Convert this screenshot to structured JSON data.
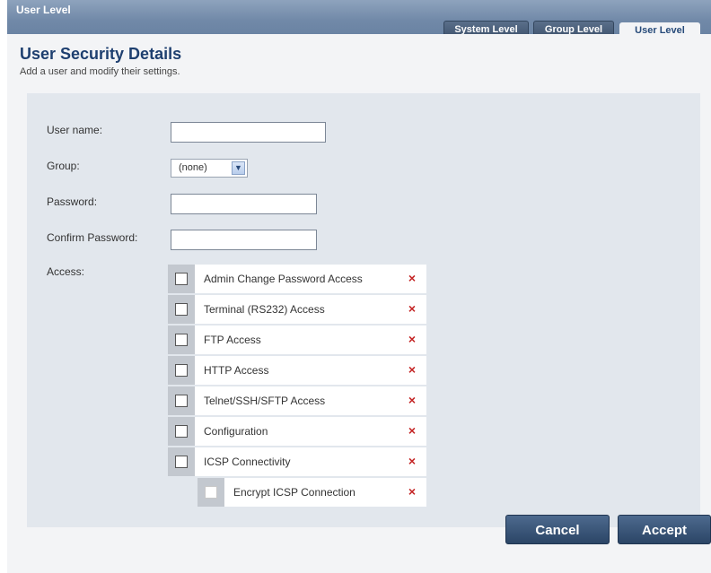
{
  "header": {
    "title": "User Level"
  },
  "tabs": [
    {
      "label": "System Level",
      "active": false
    },
    {
      "label": "Group Level",
      "active": false
    },
    {
      "label": "User Level",
      "active": true
    }
  ],
  "page": {
    "title": "User Security Details",
    "subtitle": "Add a user and modify their settings."
  },
  "form": {
    "username": {
      "label": "User name:",
      "value": ""
    },
    "group": {
      "label": "Group:",
      "selected": "(none)"
    },
    "password": {
      "label": "Password:",
      "value": ""
    },
    "confirm_password": {
      "label": "Confirm Password:",
      "value": ""
    },
    "access": {
      "label": "Access:",
      "items": [
        {
          "label": "Admin Change Password Access",
          "checked": false,
          "enabled": true
        },
        {
          "label": "Terminal (RS232) Access",
          "checked": false,
          "enabled": true
        },
        {
          "label": "FTP Access",
          "checked": false,
          "enabled": true
        },
        {
          "label": "HTTP Access",
          "checked": false,
          "enabled": true
        },
        {
          "label": "Telnet/SSH/SFTP Access",
          "checked": false,
          "enabled": true
        },
        {
          "label": "Configuration",
          "checked": false,
          "enabled": true
        },
        {
          "label": "ICSP Connectivity",
          "checked": false,
          "enabled": true
        },
        {
          "label": "Encrypt ICSP Connection",
          "checked": false,
          "enabled": false
        }
      ],
      "denied_marker": "×"
    }
  },
  "buttons": {
    "cancel": "Cancel",
    "accept": "Accept"
  },
  "colors": {
    "heading": "#1e3f6f",
    "denied": "#c42424",
    "tab_bar": "#7189a8"
  },
  "icons": {
    "dropdown": "chevron-down-icon",
    "denied": "x-icon"
  }
}
